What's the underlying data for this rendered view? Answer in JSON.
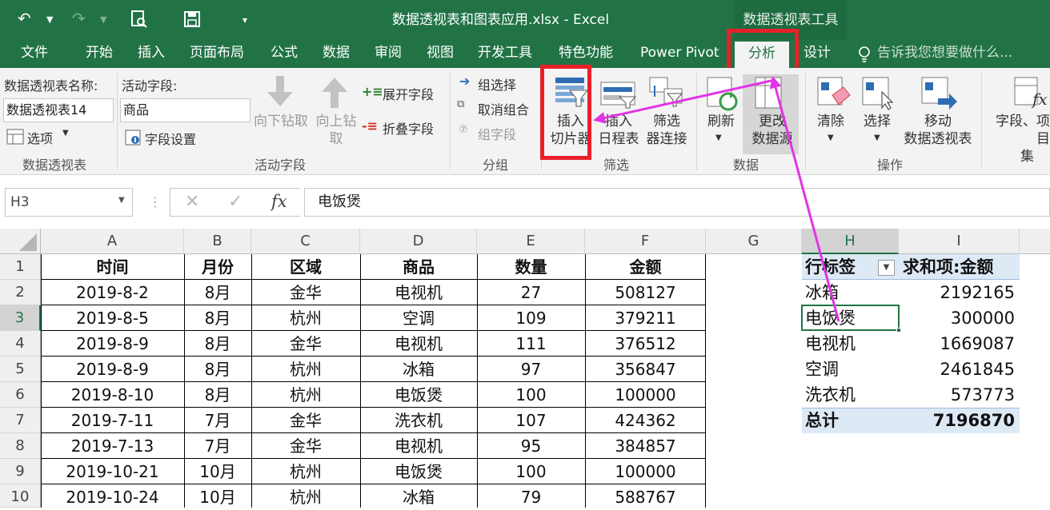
{
  "titlebar": {
    "title": "数据透视表和图表应用.xlsx - Excel",
    "context_tool": "数据透视表工具",
    "undo_icon": "undo-icon",
    "redo_icon": "redo-icon",
    "print_preview_icon": "print-preview-icon",
    "save_icon": "save-icon",
    "customize_icon": "customize-qat-icon"
  },
  "tabs": [
    "文件",
    "开始",
    "插入",
    "页面布局",
    "公式",
    "数据",
    "审阅",
    "视图",
    "开发工具",
    "特色功能",
    "Power Pivot"
  ],
  "active_tab": "分析",
  "tab_design": "设计",
  "tell_me": "告诉我您想要做什么...",
  "ribbon": {
    "pivot_group": {
      "name_label": "数据透视表名称:",
      "name_value": "数据透视表14",
      "options": "选项",
      "group": "数据透视表"
    },
    "active_field_group": {
      "label": "活动字段:",
      "value": "商品",
      "settings": "字段设置",
      "drill_down": "向下钻取",
      "drill_up_1": "向上钻",
      "drill_up_2": "取",
      "expand": "展开字段",
      "collapse": "折叠字段",
      "group": "活动字段"
    },
    "grouping": {
      "select": "组选择",
      "ungroup": "取消组合",
      "field": "组字段",
      "group": "分组"
    },
    "filter": {
      "slicer_1": "插入",
      "slicer_2": "切片器",
      "timeline_1": "插入",
      "timeline_2": "日程表",
      "conn_1": "筛选",
      "conn_2": "器连接",
      "group": "筛选"
    },
    "data": {
      "refresh": "刷新",
      "change_1": "更改",
      "change_2": "数据源",
      "group": "数据"
    },
    "actions": {
      "clear": "清除",
      "select": "选择",
      "move_1": "移动",
      "move_2": "数据透视表",
      "group": "操作"
    },
    "calc": {
      "fields_1": "字段、项目",
      "fields_2": "集"
    }
  },
  "formula_bar": {
    "name_box": "H3",
    "value": "电饭煲",
    "cancel": "✕",
    "enter": "✓",
    "fx": "fx"
  },
  "columns": [
    "A",
    "B",
    "C",
    "D",
    "E",
    "F",
    "G",
    "H",
    "I"
  ],
  "rows": [
    "1",
    "2",
    "3",
    "4",
    "5",
    "6",
    "7",
    "8",
    "9",
    "10"
  ],
  "table": {
    "headers": [
      "时间",
      "月份",
      "区域",
      "商品",
      "数量",
      "金额"
    ],
    "data": [
      [
        "2019-8-2",
        "8月",
        "金华",
        "电视机",
        "27",
        "508127"
      ],
      [
        "2019-8-5",
        "8月",
        "杭州",
        "空调",
        "109",
        "379211"
      ],
      [
        "2019-8-9",
        "8月",
        "金华",
        "电视机",
        "111",
        "376512"
      ],
      [
        "2019-8-9",
        "8月",
        "杭州",
        "冰箱",
        "97",
        "356847"
      ],
      [
        "2019-8-10",
        "8月",
        "杭州",
        "电饭煲",
        "100",
        "100000"
      ],
      [
        "2019-7-11",
        "7月",
        "金华",
        "洗衣机",
        "107",
        "424362"
      ],
      [
        "2019-7-13",
        "7月",
        "金华",
        "电视机",
        "95",
        "384857"
      ],
      [
        "2019-10-21",
        "10月",
        "杭州",
        "电饭煲",
        "100",
        "100000"
      ],
      [
        "2019-10-24",
        "10月",
        "杭州",
        "冰箱",
        "79",
        "588767"
      ]
    ]
  },
  "pivot": {
    "row_label_header": "行标签",
    "value_header": "求和项:金额",
    "rows": [
      [
        "冰箱",
        "2192165"
      ],
      [
        "电饭煲",
        "300000"
      ],
      [
        "电视机",
        "1669087"
      ],
      [
        "空调",
        "2461845"
      ],
      [
        "洗衣机",
        "573773"
      ]
    ],
    "total_label": "总计",
    "total_value": "7196870"
  },
  "colors": {
    "excel_green": "#217346",
    "highlight_red": "#e8202a",
    "arrow_magenta": "#e034e6",
    "pivot_header": "#dde9f5"
  }
}
